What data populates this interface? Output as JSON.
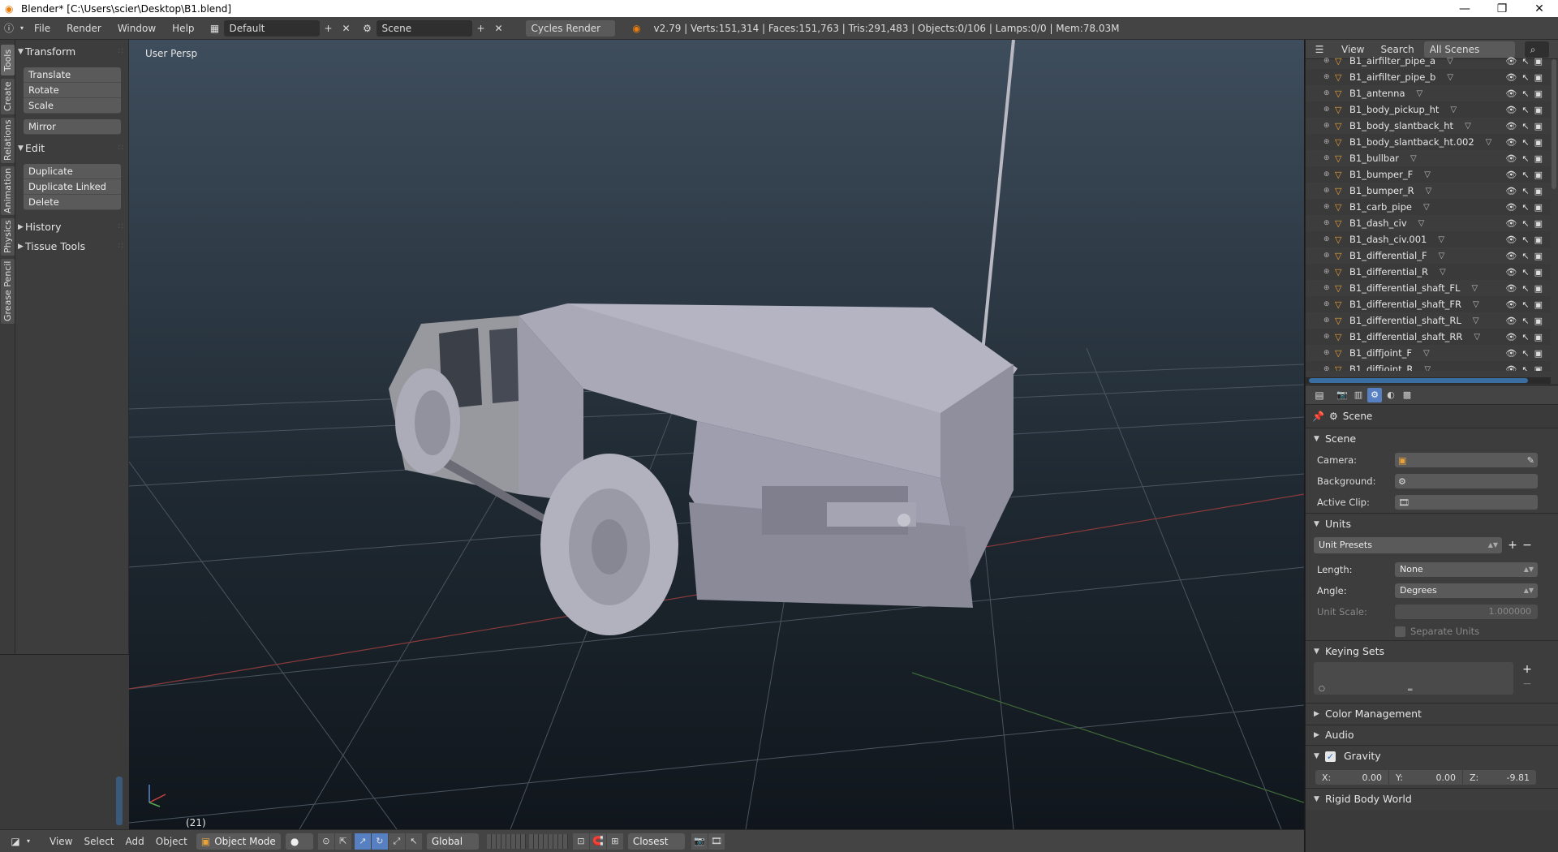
{
  "window": {
    "title": "Blender* [C:\\Users\\scier\\Desktop\\B1.blend]",
    "minimize_icon": "minimize-icon",
    "maximize_icon": "restore-icon",
    "close_icon": "close-icon"
  },
  "info_header": {
    "menus": [
      "File",
      "Render",
      "Window",
      "Help"
    ],
    "layout": "Default",
    "scene": "Scene",
    "render_engine": "Cycles Render",
    "stats": "v2.79 | Verts:151,314 | Faces:151,763 | Tris:291,483 | Objects:0/106 | Lamps:0/0 | Mem:78.03M"
  },
  "toolshelf": {
    "tabs": [
      "Tools",
      "Create",
      "Relations",
      "Animation",
      "Physics",
      "Grease Pencil"
    ],
    "panels": {
      "transform": {
        "title": "Transform",
        "buttons": [
          "Translate",
          "Rotate",
          "Scale"
        ],
        "mirror": "Mirror"
      },
      "edit": {
        "title": "Edit",
        "buttons": [
          "Duplicate",
          "Duplicate Linked",
          "Delete"
        ]
      },
      "history": "History",
      "tissue_tools": "Tissue Tools"
    }
  },
  "viewport": {
    "view_label": "User Persp",
    "frame_label": "(21)"
  },
  "viewport_header": {
    "menus": [
      "View",
      "Select",
      "Add",
      "Object"
    ],
    "mode": "Object Mode",
    "orientation": "Global",
    "snap_target": "Closest"
  },
  "outliner": {
    "view_menu": "View",
    "search_menu": "Search",
    "display_mode": "All Scenes",
    "items": [
      "B1_airfilter_pipe_a",
      "B1_airfilter_pipe_b",
      "B1_antenna",
      "B1_body_pickup_ht",
      "B1_body_slantback_ht",
      "B1_body_slantback_ht.002",
      "B1_bullbar",
      "B1_bumper_F",
      "B1_bumper_R",
      "B1_carb_pipe",
      "B1_dash_civ",
      "B1_dash_civ.001",
      "B1_differential_F",
      "B1_differential_R",
      "B1_differential_shaft_FL",
      "B1_differential_shaft_FR",
      "B1_differential_shaft_RL",
      "B1_differential_shaft_RR",
      "B1_diffjoint_F",
      "B1_diffjoint_R"
    ]
  },
  "properties": {
    "breadcrumb": "Scene",
    "scene_panel": {
      "title": "Scene",
      "camera_label": "Camera:",
      "background_label": "Background:",
      "active_clip_label": "Active Clip:"
    },
    "units_panel": {
      "title": "Units",
      "presets": "Unit Presets",
      "length_label": "Length:",
      "length_value": "None",
      "angle_label": "Angle:",
      "angle_value": "Degrees",
      "unit_scale_label": "Unit Scale:",
      "unit_scale_value": "1.000000",
      "separate_units": "Separate Units"
    },
    "keying_sets_title": "Keying Sets",
    "color_management": "Color Management",
    "audio": "Audio",
    "gravity_panel": {
      "title": "Gravity",
      "x_label": "X:",
      "x_value": "0.00",
      "y_label": "Y:",
      "y_value": "0.00",
      "z_label": "Z:",
      "z_value": "-9.81"
    },
    "rigid_body_world": "Rigid Body World"
  },
  "colors": {
    "accent": "#5680c2",
    "object_icon": "#e8a23a",
    "header_bg": "#444444",
    "panel_bg": "#3d3d3d"
  }
}
